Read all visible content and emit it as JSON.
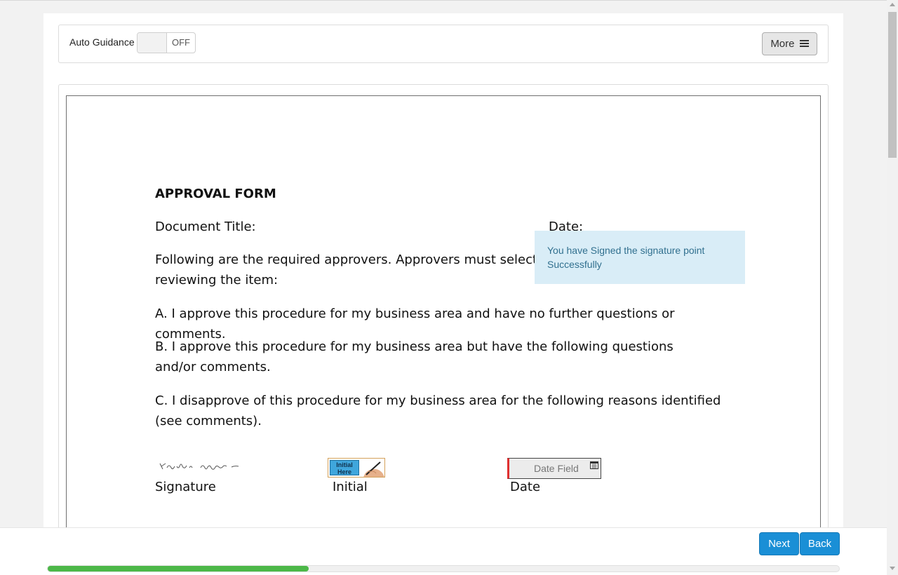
{
  "toolbar": {
    "auto_guidance_label": "Auto Guidance",
    "toggle_state": "OFF",
    "more_label": "More"
  },
  "document": {
    "form_title": "APPROVAL FORM",
    "doc_title_label": "Document Title:",
    "date_label": "Date:",
    "intro": "Following are the required approvers. Approvers must select one option below after reviewing the item:",
    "option_a": "A. I approve this procedure for my business area and have no further questions or comments.",
    "option_b": "B. I approve this procedure for my business area but have the following questions and/or comments.",
    "option_c": "C. I disapprove of this procedure for my business area for the following reasons identified (see comments).",
    "signature_caption": "Signature",
    "initial_caption": "Initial",
    "date_caption": "Date",
    "initial_button_text": "Initial Here",
    "date_field_placeholder": "Date Field",
    "signature_icon": "handwritten-signature",
    "calendar_icon": "calendar-icon"
  },
  "toast": {
    "message": "You have Signed the signature point Successfully"
  },
  "footer": {
    "next_label": "Next",
    "back_label": "Back",
    "progress_fraction": 0.33
  },
  "colors": {
    "accent_blue": "#1a8fd6",
    "progress_green": "#4cb848",
    "toast_bg": "#d9edf7",
    "toast_text": "#31708f",
    "required_red": "#e03030"
  }
}
